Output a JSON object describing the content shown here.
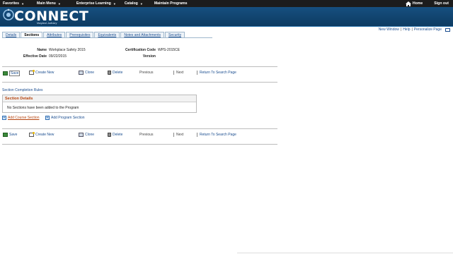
{
  "topnav": {
    "items": [
      "Favorites",
      "Main Menu",
      "Enterprise Learning",
      "Catalog",
      "Maintain Programs"
    ],
    "home": "Home",
    "signout": "Sign out"
  },
  "banner": {
    "logo": "CONNECT",
    "subtitle": "Maryland Judiciary"
  },
  "pagelinks": {
    "new_window": "New Window",
    "help": "Help",
    "personalize": "Personalize Page"
  },
  "tabs": [
    {
      "label": "Details"
    },
    {
      "label": "Sections"
    },
    {
      "label": "Attributes"
    },
    {
      "label": "Prerequisites"
    },
    {
      "label": "Equivalents"
    },
    {
      "label": "Notes and Attachments"
    },
    {
      "label": "Security"
    }
  ],
  "fields": {
    "name_label": "Name",
    "name_value": "Workplace Safety 2015",
    "cert_label": "Certification Code",
    "cert_value": "WPS-2015CE",
    "eff_label": "Effective Date",
    "eff_value": "09/22/2015",
    "version_label": "Version",
    "version_value": ""
  },
  "toolbar": {
    "save": "Save",
    "create_new": "Create New",
    "clone": "Clone",
    "delete": "Delete",
    "previous": "Previous",
    "next": "Next",
    "return": "Return To Search Page"
  },
  "section": {
    "rules_link": "Section Completion Rules",
    "grid_title": "Section Details",
    "empty_msg": "No Sections have been added to the Program",
    "add_course": "Add Course Section",
    "add_program": "Add Program Section"
  }
}
